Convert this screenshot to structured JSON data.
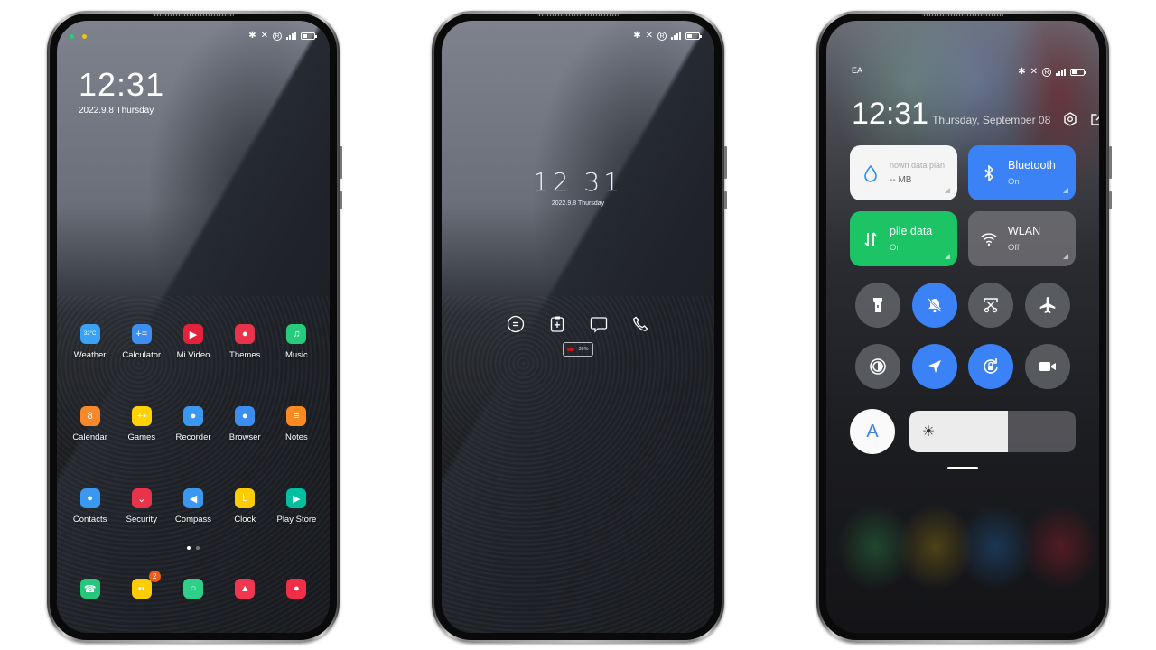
{
  "status_bar": {
    "carrier": "EA",
    "icons": [
      "bluetooth-icon",
      "mute-vibrate-icon",
      "roaming-icon",
      "signal-icon",
      "battery-icon"
    ],
    "signal_label": "E",
    "roaming_label": "R"
  },
  "home_screen": {
    "time": "12:31",
    "date": "2022.9.8 Thursday",
    "rows": [
      [
        {
          "label": "Weather",
          "icon": "weather-icon",
          "glyph": "32°C",
          "color": "#3aa2f5"
        },
        {
          "label": "Calculator",
          "icon": "calculator-icon",
          "glyph": "+=",
          "color": "#3e8ef0"
        },
        {
          "label": "Mi Video",
          "icon": "video-icon",
          "glyph": "▶",
          "color": "#e5223b"
        },
        {
          "label": "Themes",
          "icon": "themes-icon",
          "glyph": "●",
          "color": "#e8334a"
        },
        {
          "label": "Music",
          "icon": "music-icon",
          "glyph": "♫",
          "color": "#26cc7c"
        }
      ],
      [
        {
          "label": "Calendar",
          "icon": "calendar-icon",
          "glyph": "8",
          "color": "#f7882b"
        },
        {
          "label": "Games",
          "icon": "games-icon",
          "glyph": "+•",
          "color": "#ffd200"
        },
        {
          "label": "Recorder",
          "icon": "recorder-icon",
          "glyph": "●",
          "color": "#3b98f0"
        },
        {
          "label": "Browser",
          "icon": "browser-icon",
          "glyph": "●",
          "color": "#3b8ef0"
        },
        {
          "label": "Notes",
          "icon": "notes-icon",
          "glyph": "≡",
          "color": "#fb8a22"
        }
      ],
      [
        {
          "label": "Contacts",
          "icon": "contacts-icon",
          "glyph": "●",
          "color": "#3b98f0"
        },
        {
          "label": "Security",
          "icon": "security-icon",
          "glyph": "⌄",
          "color": "#e8334a"
        },
        {
          "label": "Compass",
          "icon": "compass-icon",
          "glyph": "◀",
          "color": "#3b98f0"
        },
        {
          "label": "Clock",
          "icon": "clock-icon",
          "glyph": "L",
          "color": "#ffcc00"
        },
        {
          "label": "Play Store",
          "icon": "play-store-icon",
          "glyph": "▶",
          "color": "#00c0a0"
        }
      ]
    ],
    "dock": [
      {
        "icon": "phone-icon",
        "glyph": "☎",
        "color": "#26c77d",
        "badge": ""
      },
      {
        "icon": "messages-icon",
        "glyph": "••",
        "color": "#ffcc00",
        "badge": "2"
      },
      {
        "icon": "camera-shutter-icon",
        "glyph": "○",
        "color": "#2fcf8a",
        "badge": ""
      },
      {
        "icon": "gallery-icon",
        "glyph": "▲",
        "color": "#f0374f",
        "badge": ""
      },
      {
        "icon": "camera-icon",
        "glyph": "●",
        "color": "#ef2f47",
        "badge": ""
      }
    ],
    "page_count": 2,
    "active_page": 1
  },
  "lock_screen": {
    "time": "12 31",
    "date": "2022.9.8 Thursday",
    "shortcuts": [
      "notes-icon",
      "clipboard-add-icon",
      "message-icon",
      "phone-icon"
    ],
    "battery_percent": "36%"
  },
  "control_center": {
    "time": "12:31",
    "date": "Thursday, September 08",
    "header_icons": [
      "settings-icon",
      "edit-icon"
    ],
    "tiles": [
      {
        "name": "data-usage",
        "title": "nown data plan",
        "subtitle": "-- MB",
        "style": "white",
        "icon": "water-drop-icon"
      },
      {
        "name": "bluetooth",
        "title": "Bluetooth",
        "subtitle": "On",
        "style": "blue",
        "icon": "bluetooth-icon"
      },
      {
        "name": "mobile-data",
        "title": "pile data",
        "subtitle": "On",
        "style": "green",
        "icon": "mobile-data-icon"
      },
      {
        "name": "wlan",
        "title": "WLAN",
        "subtitle": "Off",
        "style": "grey",
        "icon": "wifi-icon"
      }
    ],
    "toggles": [
      {
        "name": "flashlight",
        "icon": "flashlight-icon",
        "on": false
      },
      {
        "name": "mute",
        "icon": "bell-off-icon",
        "on": true
      },
      {
        "name": "screenshot",
        "icon": "screenshot-scissors-icon",
        "on": false
      },
      {
        "name": "airplane-mode",
        "icon": "airplane-icon",
        "on": false
      },
      {
        "name": "reading-mode",
        "icon": "contrast-icon",
        "on": false
      },
      {
        "name": "location",
        "icon": "location-arrow-icon",
        "on": true
      },
      {
        "name": "rotation-lock",
        "icon": "rotation-lock-icon",
        "on": true
      },
      {
        "name": "screen-recorder",
        "icon": "video-camera-icon",
        "on": false
      }
    ],
    "auto_brightness_label": "A",
    "brightness_level": 0.59
  }
}
